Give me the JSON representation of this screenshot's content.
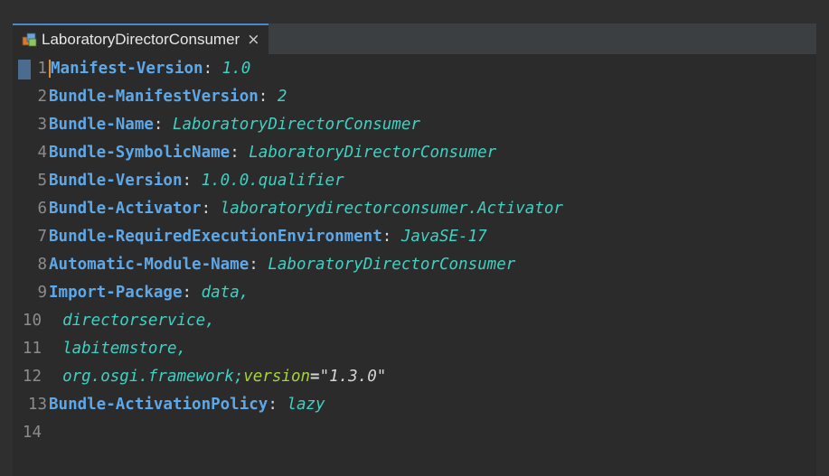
{
  "tab": {
    "icon": "plugin-manifest-icon",
    "label": "LaboratoryDirectorConsumer",
    "close_glyph": "×"
  },
  "lines": [
    {
      "n": "1",
      "key": "Manifest-Version",
      "value": "1.0"
    },
    {
      "n": "2",
      "key": "Bundle-ManifestVersion",
      "value": "2"
    },
    {
      "n": "3",
      "key": "Bundle-Name",
      "value": "LaboratoryDirectorConsumer"
    },
    {
      "n": "4",
      "key": "Bundle-SymbolicName",
      "value": "LaboratoryDirectorConsumer"
    },
    {
      "n": "5",
      "key": "Bundle-Version",
      "value": "1.0.0.qualifier"
    },
    {
      "n": "6",
      "key": "Bundle-Activator",
      "value": "laboratorydirectorconsumer.Activator"
    },
    {
      "n": "7",
      "key": "Bundle-RequiredExecutionEnvironment",
      "value": "JavaSE-17"
    },
    {
      "n": "8",
      "key": "Automatic-Module-Name",
      "value": "LaboratoryDirectorConsumer"
    },
    {
      "n": "9",
      "key": "Import-Package",
      "value": "data,"
    },
    {
      "n": "10",
      "cont": "directorservice,"
    },
    {
      "n": "11",
      "cont": "labitemstore,"
    },
    {
      "n": "12",
      "cont": "org.osgi.framework;",
      "attr": "version",
      "eq": "=",
      "str": "\"1.3.0\""
    },
    {
      "n": "13",
      "key": "Bundle-ActivationPolicy",
      "value": "lazy"
    },
    {
      "n": "14"
    }
  ],
  "colors": {
    "key": "#5fa8e8",
    "value": "#3fd1c2",
    "attribute": "#a6d33d",
    "caret": "#e08a3c",
    "tab_accent": "#4a88c7",
    "background": "#2b2b2b"
  }
}
